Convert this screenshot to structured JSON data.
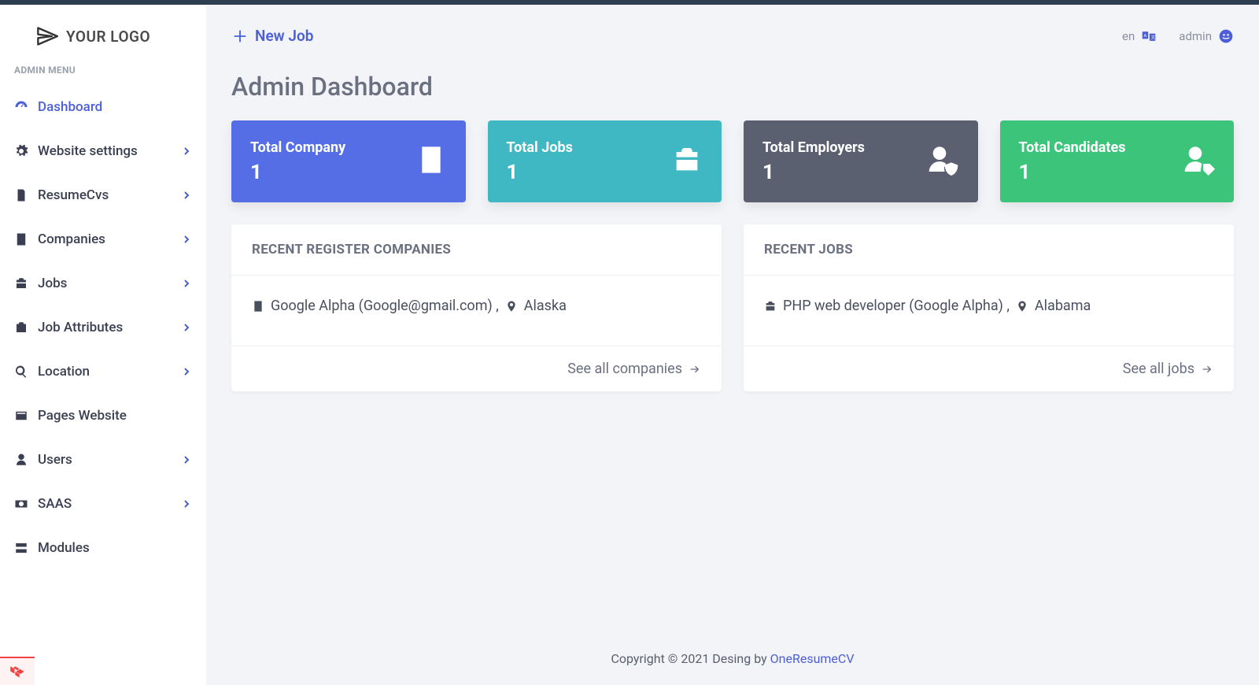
{
  "logo_text": "YOUR LOGO",
  "sidebar": {
    "heading": "ADMIN MENU",
    "items": {
      "dashboard": "Dashboard",
      "website_settings": "Website settings",
      "resumecvs": "ResumeCvs",
      "companies": "Companies",
      "jobs": "Jobs",
      "job_attributes": "Job Attributes",
      "location": "Location",
      "pages_website": "Pages Website",
      "users": "Users",
      "saas": "SAAS",
      "modules": "Modules"
    }
  },
  "header": {
    "new_job": "New Job",
    "lang": "en",
    "user": "admin"
  },
  "page_title": "Admin Dashboard",
  "cards": {
    "company": {
      "label": "Total Company",
      "value": "1"
    },
    "jobs": {
      "label": "Total Jobs",
      "value": "1"
    },
    "employers": {
      "label": "Total Employers",
      "value": "1"
    },
    "candidates": {
      "label": "Total Candidates",
      "value": "1"
    }
  },
  "panels": {
    "companies": {
      "title": "RECENT REGISTER COMPANIES",
      "row_name": "Google Alpha (Google@gmail.com) ,",
      "row_loc": "Alaska",
      "footer": "See all companies"
    },
    "jobs": {
      "title": "RECENT JOBS",
      "row_name": "PHP web developer (Google Alpha) ,",
      "row_loc": "Alabama",
      "footer": "See all jobs"
    }
  },
  "footer": {
    "text": "Copyright © 2021 Desing by ",
    "link": "OneResumeCV"
  }
}
